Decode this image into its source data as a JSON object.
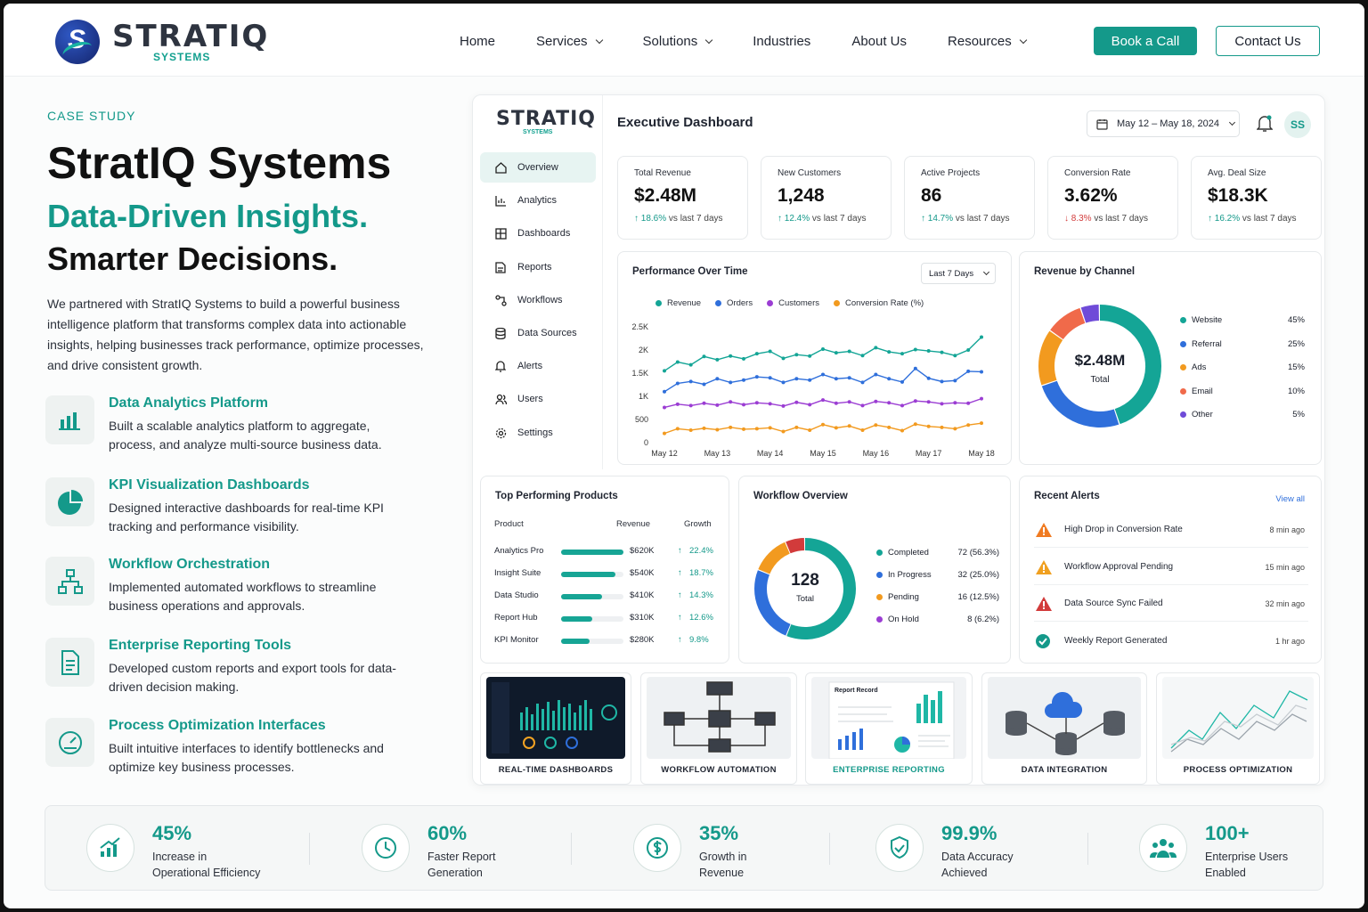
{
  "brand": {
    "name": "STRATIQ",
    "sub": "SYSTEMS"
  },
  "nav": {
    "items": [
      "Home",
      "Services",
      "Solutions",
      "Industries",
      "About Us",
      "Resources"
    ],
    "book": "Book a Call",
    "contact": "Contact Us"
  },
  "hero": {
    "eyebrow": "CASE STUDY",
    "title": "StratIQ Systems",
    "tagline1": "Data-Driven Insights.",
    "tagline2": "Smarter Decisions.",
    "intro": "We partnered with StratIQ Systems to build a powerful business intelligence platform that transforms complex data into actionable insights, helping businesses track performance, optimize processes, and drive consistent growth."
  },
  "features": [
    {
      "title": "Data Analytics Platform",
      "desc": "Built a scalable analytics platform to aggregate, process, and analyze multi-source business data.",
      "icon": "bar-chart-icon"
    },
    {
      "title": "KPI Visualization Dashboards",
      "desc": "Designed interactive dashboards for real-time KPI tracking and performance visibility.",
      "icon": "pie-chart-icon"
    },
    {
      "title": "Workflow Orchestration",
      "desc": "Implemented automated workflows to streamline business operations and approvals.",
      "icon": "workflow-icon"
    },
    {
      "title": "Enterprise Reporting Tools",
      "desc": "Developed custom reports and export tools for data-driven decision making.",
      "icon": "report-icon"
    },
    {
      "title": "Process Optimization Interfaces",
      "desc": "Built intuitive interfaces to identify bottlenecks and optimize key business processes.",
      "icon": "gauge-icon"
    }
  ],
  "dashboard": {
    "logo": "STRATIQ",
    "logo_sub": "SYSTEMS",
    "title": "Executive Dashboard",
    "date_range": "May 12 – May 18, 2024",
    "avatar": "SS",
    "sidebar": [
      "Overview",
      "Analytics",
      "Dashboards",
      "Reports",
      "Workflows",
      "Data Sources",
      "Alerts",
      "Users",
      "Settings"
    ],
    "kpis": [
      {
        "label": "Total Revenue",
        "value": "$2.48M",
        "change": "18.6%",
        "dir": "up",
        "suffix": "vs last 7 days"
      },
      {
        "label": "New Customers",
        "value": "1,248",
        "change": "12.4%",
        "dir": "up",
        "suffix": "vs last 7 days"
      },
      {
        "label": "Active Projects",
        "value": "86",
        "change": "14.7%",
        "dir": "up",
        "suffix": "vs last 7 days"
      },
      {
        "label": "Conversion Rate",
        "value": "3.62%",
        "change": "8.3%",
        "dir": "down",
        "suffix": "vs last 7 days"
      },
      {
        "label": "Avg. Deal Size",
        "value": "$18.3K",
        "change": "16.2%",
        "dir": "up",
        "suffix": "vs last 7 days"
      }
    ],
    "perf": {
      "title": "Performance Over Time",
      "select": "Last 7 Days"
    },
    "channel": {
      "title": "Revenue by Channel",
      "center_value": "$2.48M",
      "center_label": "Total"
    },
    "products": {
      "title": "Top Performing Products",
      "headers": [
        "Product",
        "Revenue",
        "Growth"
      ],
      "rows": [
        {
          "name": "Analytics Pro",
          "revenue": "$620K",
          "growth": "22.4%",
          "share": 1.0
        },
        {
          "name": "Insight Suite",
          "revenue": "$540K",
          "growth": "18.7%",
          "share": 0.87
        },
        {
          "name": "Data Studio",
          "revenue": "$410K",
          "growth": "14.3%",
          "share": 0.66
        },
        {
          "name": "Report Hub",
          "revenue": "$310K",
          "growth": "12.6%",
          "share": 0.5
        },
        {
          "name": "KPI Monitor",
          "revenue": "$280K",
          "growth": "9.8%",
          "share": 0.45
        }
      ]
    },
    "workflow": {
      "title": "Workflow Overview",
      "center_value": "128",
      "center_label": "Total"
    },
    "alerts": {
      "title": "Recent Alerts",
      "view_all": "View all",
      "items": [
        {
          "text": "High Drop in Conversion Rate",
          "time": "8 min ago",
          "type": "warning",
          "color": "#f07b22"
        },
        {
          "text": "Workflow Approval Pending",
          "time": "15 min ago",
          "type": "warning",
          "color": "#f0a020"
        },
        {
          "text": "Data Source Sync Failed",
          "time": "32 min ago",
          "type": "error",
          "color": "#d23b3b"
        },
        {
          "text": "Weekly Report Generated",
          "time": "1 hr ago",
          "type": "success",
          "color": "#14998a"
        }
      ]
    },
    "thumbs": [
      {
        "label": "REAL-TIME DASHBOARDS"
      },
      {
        "label": "WORKFLOW AUTOMATION"
      },
      {
        "label": "ENTERPRISE REPORTING",
        "sub": "Report Record"
      },
      {
        "label": "DATA INTEGRATION"
      },
      {
        "label": "PROCESS OPTIMIZATION"
      }
    ]
  },
  "stats": [
    {
      "value": "45%",
      "label1": "Increase in",
      "label2": "Operational Efficiency",
      "icon": "growth-chart-icon"
    },
    {
      "value": "60%",
      "label1": "Faster Report",
      "label2": "Generation",
      "icon": "clock-icon"
    },
    {
      "value": "35%",
      "label1": "Growth in",
      "label2": "Revenue",
      "icon": "dollar-icon"
    },
    {
      "value": "99.9%",
      "label1": "Data Accuracy",
      "label2": "Achieved",
      "icon": "shield-check-icon"
    },
    {
      "value": "100+",
      "label1": "Enterprise Users",
      "label2": "Enabled",
      "icon": "users-icon"
    }
  ],
  "chart_data": [
    {
      "type": "line",
      "title": "Performance Over Time",
      "categories": [
        "May 12",
        "May 13",
        "May 14",
        "May 15",
        "May 16",
        "May 17",
        "May 18"
      ],
      "ylim": [
        0,
        2500
      ],
      "yticks": [
        "0",
        "500",
        "1K",
        "1.5K",
        "2K",
        "2.5K"
      ],
      "grid": false,
      "legend": "top",
      "x": [
        0,
        0.5,
        1,
        1.5,
        2,
        2.5,
        3,
        3.5,
        4,
        4.5,
        5,
        5.5,
        6,
        6.5,
        7,
        7.5,
        8,
        8.5,
        9,
        9.5,
        10,
        10.5,
        11,
        11.5,
        12
      ],
      "series": [
        {
          "name": "Revenue",
          "color": "#14a596",
          "values": [
            1550,
            1740,
            1680,
            1860,
            1790,
            1870,
            1810,
            1920,
            1970,
            1820,
            1900,
            1870,
            2020,
            1940,
            1970,
            1880,
            2050,
            1960,
            1920,
            2010,
            1980,
            1950,
            1880,
            2000,
            2280
          ]
        },
        {
          "name": "Orders",
          "color": "#2f6fdb",
          "values": [
            1100,
            1280,
            1320,
            1260,
            1380,
            1300,
            1350,
            1420,
            1400,
            1300,
            1380,
            1350,
            1470,
            1380,
            1400,
            1300,
            1470,
            1380,
            1310,
            1600,
            1390,
            1320,
            1340,
            1540,
            1530
          ]
        },
        {
          "name": "Customers",
          "color": "#9b3dd3",
          "values": [
            760,
            830,
            800,
            850,
            810,
            880,
            820,
            860,
            840,
            790,
            870,
            820,
            920,
            850,
            880,
            800,
            890,
            860,
            800,
            900,
            880,
            840,
            860,
            850,
            950
          ]
        },
        {
          "name": "Conversion Rate (%)",
          "color": "#f29a1f",
          "values": [
            200,
            300,
            270,
            310,
            280,
            330,
            290,
            300,
            320,
            240,
            330,
            270,
            390,
            320,
            360,
            270,
            380,
            330,
            260,
            400,
            350,
            330,
            300,
            380,
            420
          ]
        }
      ]
    },
    {
      "type": "pie",
      "title": "Revenue by Channel",
      "categories": [
        "Website",
        "Referral",
        "Ads",
        "Email",
        "Other"
      ],
      "values": [
        45,
        25,
        15,
        10,
        5
      ],
      "colors": [
        "#14a596",
        "#2f6fdb",
        "#f29a1f",
        "#f06a4a",
        "#6f4bd8"
      ]
    },
    {
      "type": "pie",
      "title": "Workflow Overview",
      "categories": [
        "Completed",
        "In Progress",
        "Pending",
        "On Hold"
      ],
      "values": [
        72,
        32,
        16,
        8
      ],
      "labels": [
        "72 (56.3%)",
        "32 (25.0%)",
        "16 (12.5%)",
        "8 (6.2%)"
      ],
      "colors": [
        "#14a596",
        "#2f6fdb",
        "#f29a1f",
        "#d23b3b"
      ],
      "legend_colors": [
        "#14a596",
        "#2f6fdb",
        "#f29a1f",
        "#9b3dd3"
      ]
    }
  ]
}
